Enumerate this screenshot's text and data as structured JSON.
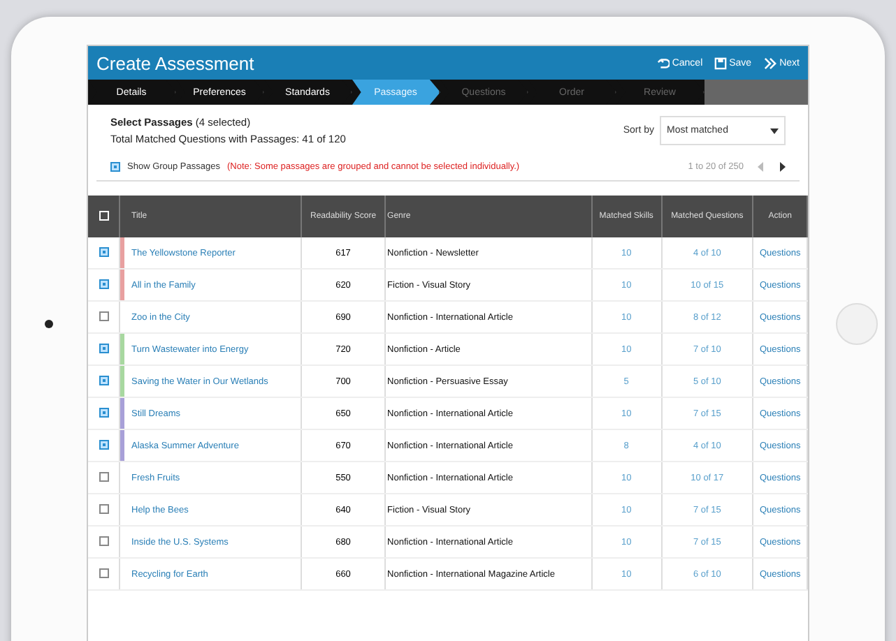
{
  "header": {
    "title": "Create Assessment",
    "actions": [
      {
        "kind": "undo",
        "label": "Cancel"
      },
      {
        "kind": "save",
        "label": "Save"
      },
      {
        "kind": "next",
        "label": "Next"
      }
    ]
  },
  "steps": [
    {
      "label": "Details",
      "selected": false,
      "done": true
    },
    {
      "label": "Preferences",
      "selected": false,
      "done": true
    },
    {
      "label": "Standards",
      "selected": false,
      "done": true
    },
    {
      "label": "Passages",
      "selected": true,
      "done": false
    },
    {
      "label": "Questions",
      "selected": false,
      "done": false
    },
    {
      "label": "Order",
      "selected": false,
      "done": false
    },
    {
      "label": "Review",
      "selected": false,
      "done": false
    }
  ],
  "summary": {
    "title": "Select Passages",
    "count": "(4 selected)",
    "total": "Total Matched Questions with Passages: 41 of 120"
  },
  "sort": {
    "label": "Sort by",
    "value": "Most matched"
  },
  "group_toggle": {
    "label": "Show Group Passages",
    "checked": true,
    "note": "(Note: Some passages are grouped and cannot be selected individually.)"
  },
  "pagination": {
    "range": "1 to 20 of 250"
  },
  "table": {
    "all_checked": false,
    "columns": [
      "Title",
      "Readability Score",
      "Genre",
      "Matched Skills",
      "Matched Questions",
      "Action"
    ],
    "rows": [
      {
        "checked": true,
        "color": "#e8a0a0",
        "title": "The Yellowstone Reporter",
        "score": "617",
        "genre": "Nonfiction - Newsletter",
        "skills": "10",
        "questions": "4 of 10",
        "action": "Questions"
      },
      {
        "checked": true,
        "color": "#e8a0a0",
        "title": "All in the Family",
        "score": "620",
        "genre": "Fiction - Visual Story",
        "skills": "10",
        "questions": "10 of 15",
        "action": "Questions"
      },
      {
        "checked": false,
        "title": "Zoo in the City",
        "score": "690",
        "genre": "Nonfiction - International Article",
        "skills": "10",
        "questions": "8 of 12",
        "action": "Questions"
      },
      {
        "checked": true,
        "color": "#a8d8a0",
        "title": "Turn Wastewater into Energy",
        "score": "720",
        "genre": "Nonfiction - Article",
        "skills": "10",
        "questions": "7 of 10",
        "action": "Questions"
      },
      {
        "checked": true,
        "color": "#a8d8a0",
        "title": "Saving the Water in Our Wetlands",
        "score": "700",
        "genre": "Nonfiction - Persuasive Essay",
        "skills": "5",
        "questions": "5 of 10",
        "action": "Questions"
      },
      {
        "checked": true,
        "color": "#a8a0d8",
        "title": "Still Dreams",
        "score": "650",
        "genre": "Nonfiction - International Article",
        "skills": "10",
        "questions": "7 of 15",
        "action": "Questions"
      },
      {
        "checked": true,
        "color": "#a8a0d8",
        "title": "Alaska Summer Adventure",
        "score": "670",
        "genre": "Nonfiction - International Article",
        "skills": "8",
        "questions": "4 of 10",
        "action": "Questions"
      },
      {
        "checked": false,
        "title": "Fresh Fruits",
        "score": "550",
        "genre": "Nonfiction - International Article",
        "skills": "10",
        "questions": "10 of 17",
        "action": "Questions"
      },
      {
        "checked": false,
        "title": "Help the Bees",
        "score": "640",
        "genre": "Fiction - Visual Story",
        "skills": "10",
        "questions": "7 of 15",
        "action": "Questions"
      },
      {
        "checked": false,
        "title": "Inside the U.S. Systems",
        "score": "680",
        "genre": "Nonfiction - International Article",
        "skills": "10",
        "questions": "7 of 15",
        "action": "Questions"
      },
      {
        "checked": false,
        "title": "Recycling for Earth",
        "score": "660",
        "genre": "Nonfiction - International Magazine Article",
        "skills": "10",
        "questions": "6 of 10",
        "action": "Questions"
      }
    ]
  }
}
